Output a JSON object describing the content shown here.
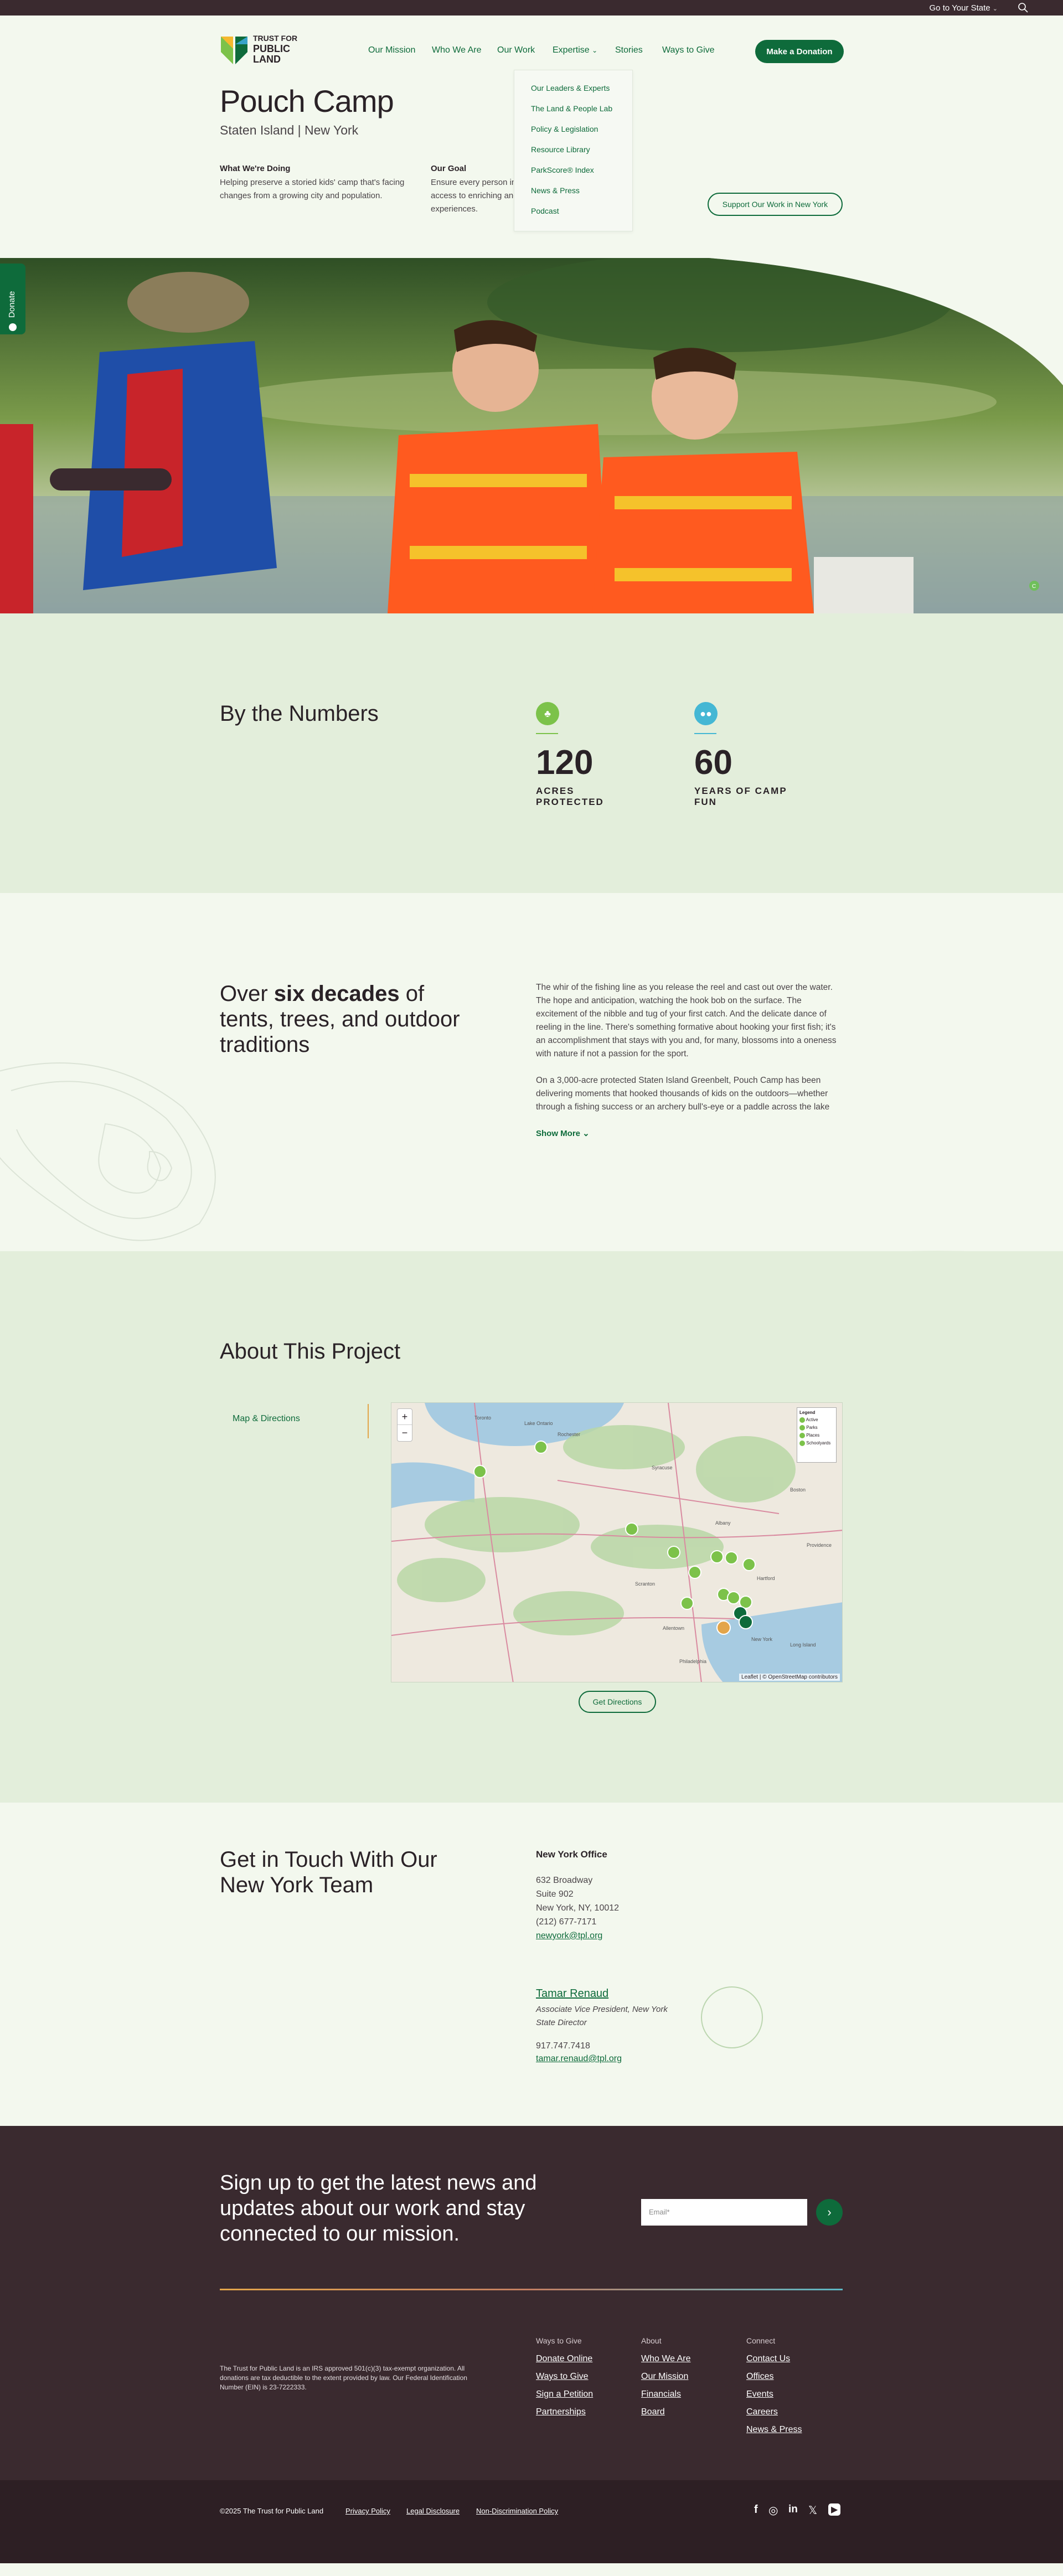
{
  "topbar": {
    "state_label": "Go to Your State",
    "chevron": "⌄"
  },
  "header": {
    "logo_text": [
      "TRUST FOR",
      "PUBLIC",
      "LAND"
    ],
    "nav": [
      "Our Mission",
      "Who We Are",
      "Our Work",
      "Expertise",
      "Stories",
      "Ways to Give"
    ],
    "expertise_chevron": "⌄",
    "donate_label": "Make a Donation",
    "dropdown": [
      "Our Leaders & Experts",
      "The Land & People Lab",
      "Policy & Legislation",
      "Resource Library",
      "ParkScore® Index",
      "News & Press",
      "Podcast"
    ]
  },
  "page": {
    "title": "Pouch Camp",
    "subtitle": "Staten Island | New York",
    "doing_label": "What We're Doing",
    "doing_text": "Helping preserve a storied kids' camp that's facing changes from a growing city and population.",
    "goal_label": "Our Goal",
    "goal_text": "Ensure every person in New York has close-to-home access to enriching and meaningful outdoor experiences.",
    "support_btn": "Support Our Work in New York"
  },
  "donate_tab": "Donate",
  "hero": {
    "credit": "C"
  },
  "numbers": {
    "heading": "By the Numbers",
    "stats": [
      {
        "icon": "tree-icon",
        "value": "120",
        "label_line1": "ACRES",
        "label_line2": "PROTECTED"
      },
      {
        "icon": "people-icon",
        "value": "60",
        "label_line1": "YEARS OF CAMP",
        "label_line2": "FUN"
      }
    ]
  },
  "story": {
    "heading_pre": "Over ",
    "heading_bold": "six decades",
    "heading_post": " of tents, trees, and outdoor traditions",
    "p1": "The whir of the fishing line as you release the reel and cast out over the water. The hope and anticipation, watching the hook bob on the surface. The excitement of the nibble and tug of your first catch. And the delicate dance of reeling in the line. There's something formative about hooking your first fish; it's an accomplishment that stays with you and, for many, blossoms into a oneness with nature if not a passion for the sport.",
    "p2": "On a 3,000-acre protected Staten Island Greenbelt, Pouch Camp has been delivering moments that hooked thousands of kids on the outdoors—whether through a fishing success or an archery bull's-eye or a paddle across the lake",
    "show_more": "Show More ⌄"
  },
  "about": {
    "heading": "About This Project",
    "tab": "Map & Directions",
    "map_legend_title": "Legend",
    "map_legend": [
      "Active",
      "Parks",
      "Places",
      "Schoolyards"
    ],
    "map_places": [
      "Toronto",
      "Rochester",
      "Syracuse",
      "Albany",
      "Boston",
      "Scranton",
      "Hartford",
      "Providence",
      "New York",
      "Philadelphia",
      "Allentown",
      "Lake Ontario",
      "Long Island"
    ],
    "map_attribution": "Leaflet | © OpenStreetMap contributors",
    "zoom_in": "+",
    "zoom_out": "−",
    "directions_btn": "Get Directions"
  },
  "contact": {
    "heading": "Get in Touch With Our New York Team",
    "office_title": "New York Office",
    "address": [
      "632 Broadway",
      "Suite 902",
      "New York, NY, 10012",
      "(212) 677-7171"
    ],
    "email": "newyork@tpl.org",
    "person_name": "Tamar Renaud",
    "person_title": [
      "Associate Vice President, New York",
      "State Director"
    ],
    "phone": "917.747.7418",
    "person_email": "tamar.renaud@tpl.org"
  },
  "signup": {
    "heading": "Sign up to get the latest news and updates about our work and stay connected to our mission.",
    "placeholder": "Email*",
    "submit": "›"
  },
  "footer": {
    "legal": "The Trust for Public Land is an IRS approved 501(c)(3) tax-exempt organization. All donations are tax deductible to the extent provided by law. Our Federal Identification Number (EIN) is 23-7222333.",
    "col1_title": "Ways to Give",
    "col1": [
      "Donate Online",
      "Ways to Give",
      "Sign a Petition",
      "Partnerships"
    ],
    "col2_title": "About",
    "col2": [
      "Who We Are",
      "Our Mission",
      "Financials",
      "Board"
    ],
    "col3_title": "Connect",
    "col3": [
      "Contact Us",
      "Offices",
      "Events",
      "Careers",
      "News & Press"
    ]
  },
  "bottom": {
    "copyright": "©2025 The Trust for Public Land",
    "links": [
      "Privacy Policy",
      "Legal Disclosure",
      "Non-Discrimination Policy"
    ],
    "social": [
      "f",
      "◎",
      "in",
      "𝕏",
      "▶"
    ]
  },
  "colors": {
    "brand": "#0e6b3b",
    "accent": "#6fbf5a",
    "footer": "#3a2a2f",
    "numbers_bg": "#e3eedb"
  }
}
